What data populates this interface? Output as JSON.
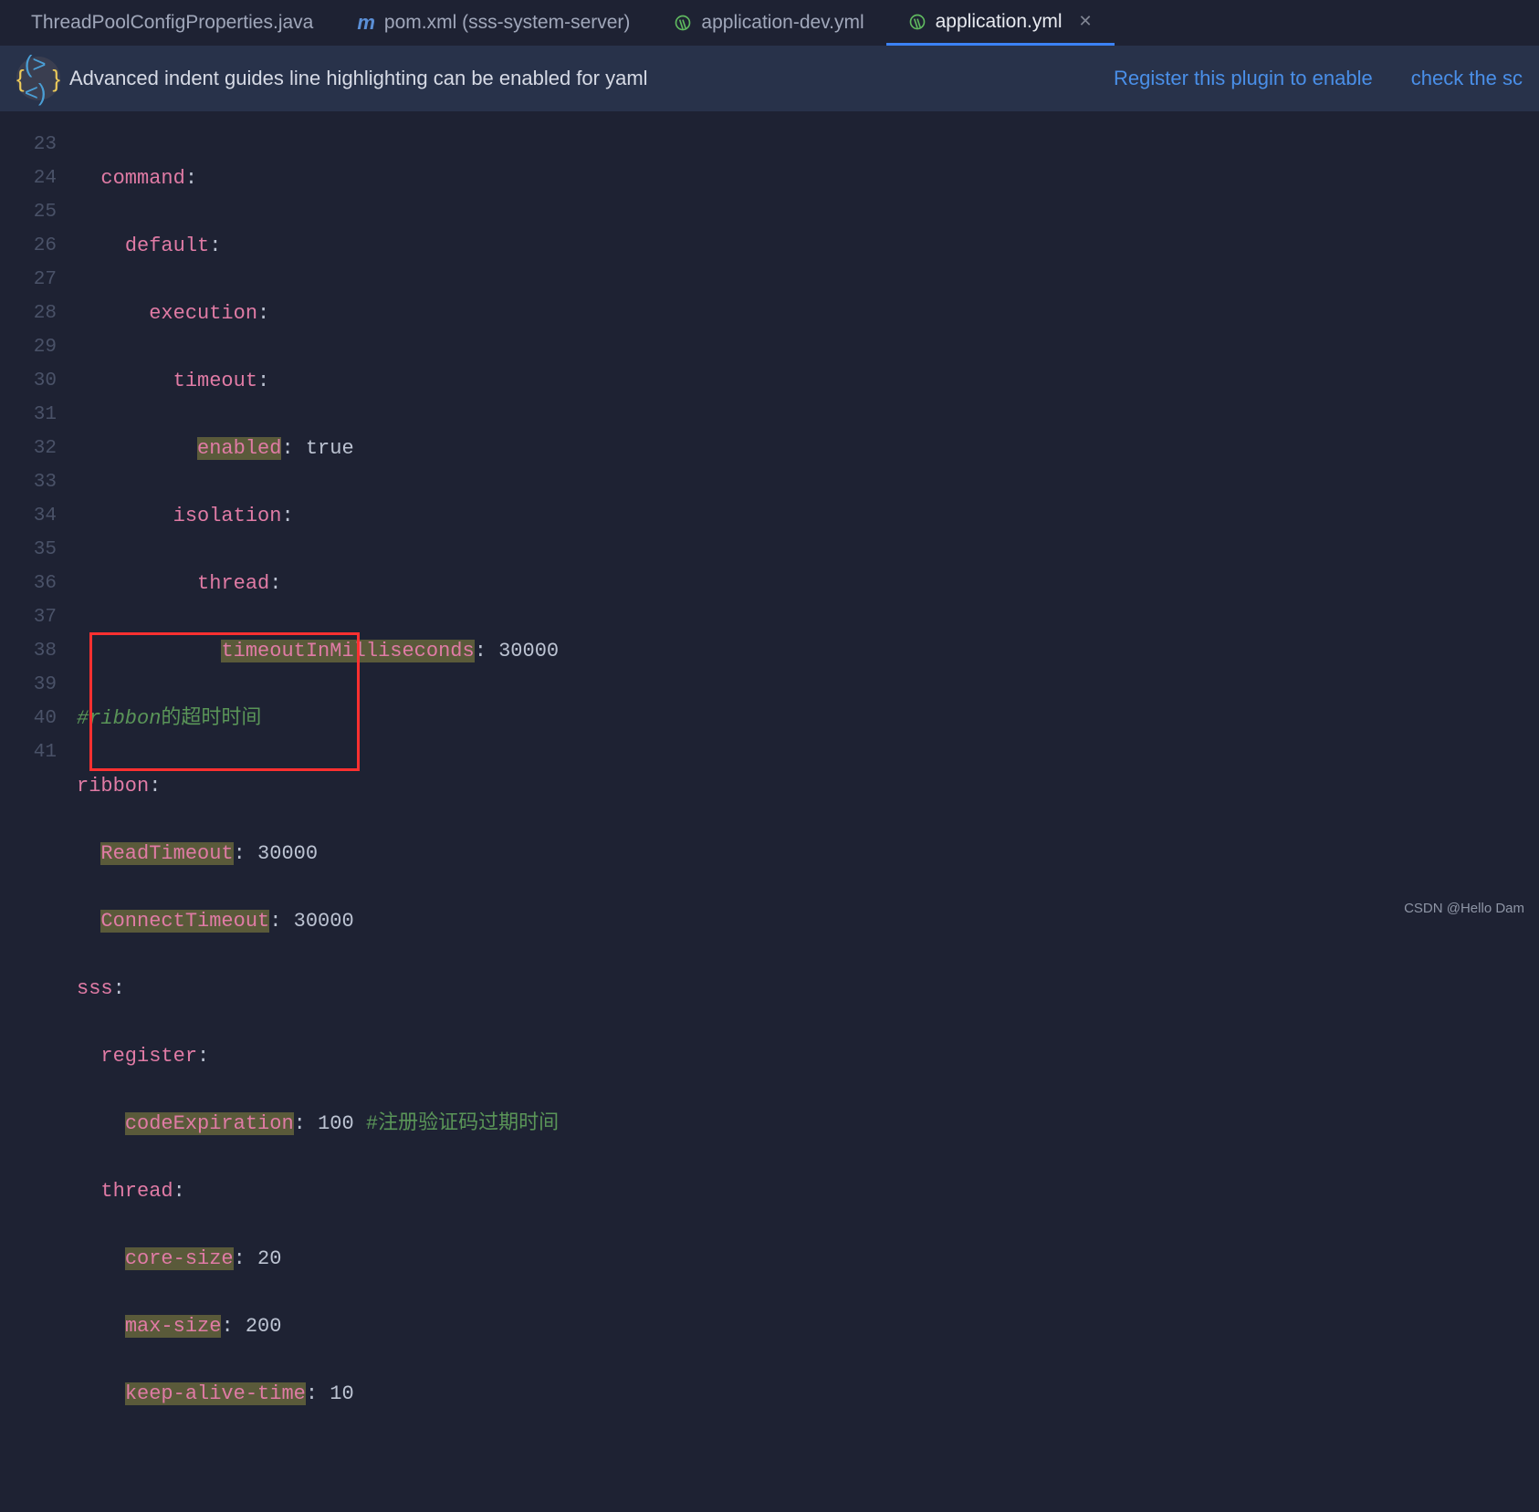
{
  "tabs": [
    {
      "label": "ThreadPoolConfigProperties.java",
      "icon": "java",
      "active": false
    },
    {
      "label": "pom.xml (sss-system-server)",
      "icon": "m",
      "active": false
    },
    {
      "label": "application-dev.yml",
      "icon": "yml",
      "active": false
    },
    {
      "label": "application.yml",
      "icon": "yml",
      "active": true
    }
  ],
  "banner": {
    "text": "Advanced indent guides line highlighting can be enabled for yaml",
    "link1": "Register this plugin to enable",
    "link2": "check the sc"
  },
  "lines": {
    "start": 23,
    "end": 41
  },
  "code": {
    "l23": {
      "indent": "  ",
      "key": "command",
      "sep": ":"
    },
    "l24": {
      "indent": "    ",
      "key": "default",
      "sep": ":"
    },
    "l25": {
      "indent": "      ",
      "key": "execution",
      "sep": ":"
    },
    "l26": {
      "indent": "        ",
      "key": "timeout",
      "sep": ":"
    },
    "l27": {
      "indent": "          ",
      "key": "enabled",
      "sep": ": ",
      "val": "true",
      "hl": true
    },
    "l28": {
      "indent": "        ",
      "key": "isolation",
      "sep": ":"
    },
    "l29": {
      "indent": "          ",
      "key": "thread",
      "sep": ":"
    },
    "l30": {
      "indent": "            ",
      "key": "timeoutInMilliseconds",
      "sep": ": ",
      "val": "30000",
      "hl": true
    },
    "l31": {
      "comment_pre": "#ribbon",
      "comment_zh": "的超时时间"
    },
    "l32": {
      "indent": "",
      "key": "ribbon",
      "sep": ":"
    },
    "l33": {
      "indent": "  ",
      "key": "ReadTimeout",
      "sep": ": ",
      "val": "30000",
      "hl": true
    },
    "l34": {
      "indent": "  ",
      "key": "ConnectTimeout",
      "sep": ": ",
      "val": "30000",
      "hl": true
    },
    "l35": {
      "indent": "",
      "key": "sss",
      "sep": ":"
    },
    "l36": {
      "indent": "  ",
      "key": "register",
      "sep": ":"
    },
    "l37": {
      "indent": "    ",
      "key": "codeExpiration",
      "sep": ": ",
      "val": "100",
      "hl": true,
      "trail_comment": " #注册验证码过期时间"
    },
    "l38": {
      "indent": "  ",
      "key": "thread",
      "sep": ":"
    },
    "l39": {
      "indent": "    ",
      "key": "core-size",
      "sep": ": ",
      "val": "20",
      "hl": true
    },
    "l40": {
      "indent": "    ",
      "key": "max-size",
      "sep": ": ",
      "val": "200",
      "hl": true
    },
    "l41": {
      "indent": "    ",
      "key": "keep-alive-time",
      "sep": ": ",
      "val": "10",
      "hl": true
    }
  },
  "watermark": "CSDN @Hello Dam"
}
